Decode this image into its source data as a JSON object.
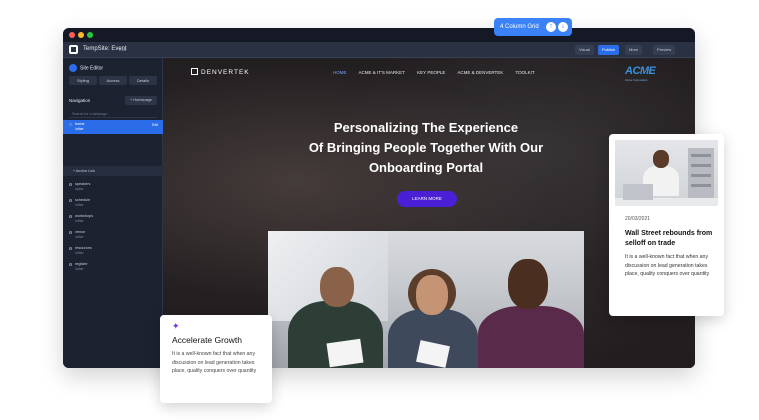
{
  "toolbar": {
    "grid_badge": "4 Column Grid",
    "app_title": "TempSite: Event",
    "app_tag": "Edit",
    "btn_visual": "Visual",
    "btn_publish": "Publish",
    "btn_more": "More",
    "btn_preview": "Preview"
  },
  "sidebar": {
    "title": "Site Editor",
    "buttons": [
      "Styling",
      "Access",
      "Details"
    ],
    "nav_title": "Navigation",
    "add_page": "+ Homepage",
    "search_placeholder": "Search for a webpage...",
    "anchor_link": "+ Anchor Link",
    "pages": [
      {
        "name": "home",
        "slug": "/other",
        "active": true,
        "edit": "Edit"
      },
      {
        "name": "speakers",
        "slug": "/spea"
      },
      {
        "name": "schedule",
        "slug": "/other"
      },
      {
        "name": "workshops",
        "slug": "/other"
      },
      {
        "name": "venue",
        "slug": "/other"
      },
      {
        "name": "resources",
        "slug": "/other"
      },
      {
        "name": "register",
        "slug": "/other"
      }
    ]
  },
  "site": {
    "logo": "DENVERTEK",
    "nav": [
      "HOME",
      "ACME & IT'S MARKET",
      "KEY PEOPLE",
      "ACME & DENVERTEK",
      "TOOLKIT"
    ],
    "partner_logo": "ACME",
    "partner_sub": "Acme Corporation",
    "hero_line1": "Personalizing The Experience",
    "hero_line2": "Of Bringing People Together With Our",
    "hero_line3": "Onboarding Portal",
    "hero_button": "LEARN MORE"
  },
  "news_card": {
    "date": "20/03/2021",
    "title": "Wall Street rebounds from selloff on trade",
    "text": "It is a well-known fact that when any discussion on lead generation takes place, quality conquers over quantity"
  },
  "accelerate_card": {
    "icon": "sparkle-icon",
    "title": "Accelerate Growth",
    "text": "It is a well-known fact that when any discussion on lead generation takes place, quality conquers over quantity"
  },
  "colors": {
    "accent": "#4a1fd6",
    "primary_blue": "#2b6de8",
    "badge_blue": "#3b82f6"
  }
}
